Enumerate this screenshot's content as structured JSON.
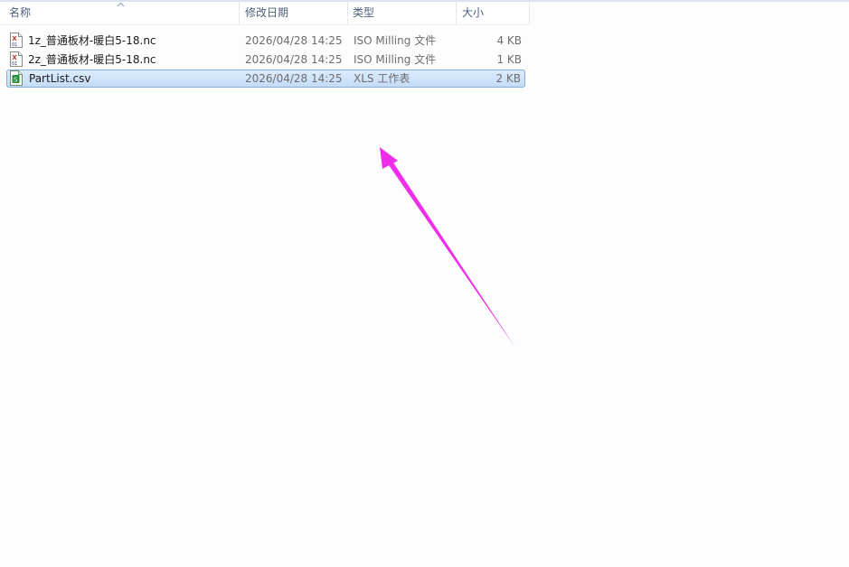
{
  "columns": {
    "name": "名称",
    "modified": "修改日期",
    "type": "类型",
    "size": "大小"
  },
  "files": [
    {
      "name": "1z_普通板材-暖白5-18.nc",
      "modified": "2026/04/28 14:25",
      "type": "ISO Milling 文件",
      "size": "4 KB",
      "icon": "nc-file-icon",
      "selected": false
    },
    {
      "name": "2z_普通板材-暖白5-18.nc",
      "modified": "2026/04/28 14:25",
      "type": "ISO Milling 文件",
      "size": "1 KB",
      "icon": "nc-file-icon",
      "selected": false
    },
    {
      "name": "PartList.csv",
      "modified": "2026/04/28 14:25",
      "type": "XLS 工作表",
      "size": "2 KB",
      "icon": "csv-file-icon",
      "selected": true
    }
  ],
  "colors": {
    "annotation_arrow": "#ee2ee8",
    "selection_border": "#84acdd",
    "header_text": "#4c607a"
  },
  "sort": {
    "column": "name",
    "direction": "ascending",
    "icon": "sort-ascending-icon"
  }
}
